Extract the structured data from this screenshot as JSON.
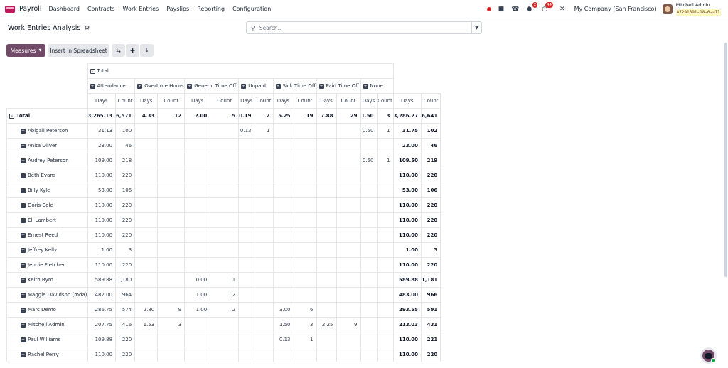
{
  "nav": {
    "app_name": "Payroll",
    "menu": [
      "Dashboard",
      "Contracts",
      "Work Entries",
      "Payslips",
      "Reporting",
      "Configuration"
    ],
    "messages_badge": "2",
    "activities_badge": "44",
    "company": "My Company (San Francisco)",
    "user_name": "Mitchell Admin",
    "db_name": "87291891-18-0-all"
  },
  "control": {
    "title": "Work Entries Analysis",
    "search_placeholder": "Search...",
    "measures_label": "Measures",
    "spreadsheet_label": "Insert in Spreadsheet"
  },
  "pivot": {
    "total_label": "Total",
    "column_groups": [
      "Attendance",
      "Overtime Hours",
      "Generic Time Off",
      "Unpaid",
      "Sick Time Off",
      "Paid Time Off",
      "None"
    ],
    "measures": [
      "Days",
      "Count"
    ],
    "total_row": {
      "label": "Total",
      "cells": [
        "3,265.13",
        "6,571",
        "4.33",
        "12",
        "2.00",
        "5",
        "0.19",
        "2",
        "5.25",
        "19",
        "7.88",
        "29",
        "1.50",
        "3",
        "3,286.27",
        "6,641"
      ]
    },
    "rows": [
      {
        "label": "Abigail Peterson",
        "cells": [
          "31.13",
          "100",
          "",
          "",
          "",
          "",
          "0.13",
          "1",
          "",
          "",
          "",
          "",
          "0.50",
          "1",
          "31.75",
          "102"
        ]
      },
      {
        "label": "Anita Oliver",
        "cells": [
          "23.00",
          "46",
          "",
          "",
          "",
          "",
          "",
          "",
          "",
          "",
          "",
          "",
          "",
          "",
          "23.00",
          "46"
        ]
      },
      {
        "label": "Audrey Peterson",
        "cells": [
          "109.00",
          "218",
          "",
          "",
          "",
          "",
          "",
          "",
          "",
          "",
          "",
          "",
          "0.50",
          "1",
          "109.50",
          "219"
        ]
      },
      {
        "label": "Beth Evans",
        "cells": [
          "110.00",
          "220",
          "",
          "",
          "",
          "",
          "",
          "",
          "",
          "",
          "",
          "",
          "",
          "",
          "110.00",
          "220"
        ]
      },
      {
        "label": "Billy Kyle",
        "cells": [
          "53.00",
          "106",
          "",
          "",
          "",
          "",
          "",
          "",
          "",
          "",
          "",
          "",
          "",
          "",
          "53.00",
          "106"
        ]
      },
      {
        "label": "Doris Cole",
        "cells": [
          "110.00",
          "220",
          "",
          "",
          "",
          "",
          "",
          "",
          "",
          "",
          "",
          "",
          "",
          "",
          "110.00",
          "220"
        ]
      },
      {
        "label": "Eli Lambert",
        "cells": [
          "110.00",
          "220",
          "",
          "",
          "",
          "",
          "",
          "",
          "",
          "",
          "",
          "",
          "",
          "",
          "110.00",
          "220"
        ]
      },
      {
        "label": "Ernest Reed",
        "cells": [
          "110.00",
          "220",
          "",
          "",
          "",
          "",
          "",
          "",
          "",
          "",
          "",
          "",
          "",
          "",
          "110.00",
          "220"
        ]
      },
      {
        "label": "Jeffrey Kelly",
        "cells": [
          "1.00",
          "3",
          "",
          "",
          "",
          "",
          "",
          "",
          "",
          "",
          "",
          "",
          "",
          "",
          "1.00",
          "3"
        ]
      },
      {
        "label": "Jennie Fletcher",
        "cells": [
          "110.00",
          "220",
          "",
          "",
          "",
          "",
          "",
          "",
          "",
          "",
          "",
          "",
          "",
          "",
          "110.00",
          "220"
        ]
      },
      {
        "label": "Keith Byrd",
        "cells": [
          "589.88",
          "1,180",
          "",
          "",
          "0.00",
          "1",
          "",
          "",
          "",
          "",
          "",
          "",
          "",
          "",
          "589.88",
          "1,181"
        ]
      },
      {
        "label": "Maggie Davidson (mda)",
        "cells": [
          "482.00",
          "964",
          "",
          "",
          "1.00",
          "2",
          "",
          "",
          "",
          "",
          "",
          "",
          "",
          "",
          "483.00",
          "966"
        ]
      },
      {
        "label": "Marc Demo",
        "cells": [
          "286.75",
          "574",
          "2.80",
          "9",
          "1.00",
          "2",
          "",
          "",
          "3.00",
          "6",
          "",
          "",
          "",
          "",
          "293.55",
          "591"
        ]
      },
      {
        "label": "Mitchell Admin",
        "cells": [
          "207.75",
          "416",
          "1.53",
          "3",
          "",
          "",
          "",
          "",
          "1.50",
          "3",
          "2.25",
          "9",
          "",
          "",
          "213.03",
          "431"
        ]
      },
      {
        "label": "Paul Williams",
        "cells": [
          "109.88",
          "220",
          "",
          "",
          "",
          "",
          "",
          "",
          "0.13",
          "1",
          "",
          "",
          "",
          "",
          "110.00",
          "221"
        ]
      },
      {
        "label": "Rachel Perry",
        "cells": [
          "110.00",
          "220",
          "",
          "",
          "",
          "",
          "",
          "",
          "",
          "",
          "",
          "",
          "",
          "",
          "110.00",
          "220"
        ]
      }
    ]
  },
  "icons": {
    "app": "payroll-app-icon",
    "status": "status-red-dot",
    "building": "building-icon",
    "phone": "phone-icon",
    "messages": "chat-icon",
    "activities": "clock-icon",
    "debug": "tools-icon",
    "settings": "gear-icon",
    "search": "search-icon",
    "swap": "swap-axis-icon",
    "expand": "expand-all-icon",
    "download": "download-icon"
  },
  "colors": {
    "primary": "#714b67",
    "badge": "#dc2626",
    "app_icon": "#c2185b"
  }
}
